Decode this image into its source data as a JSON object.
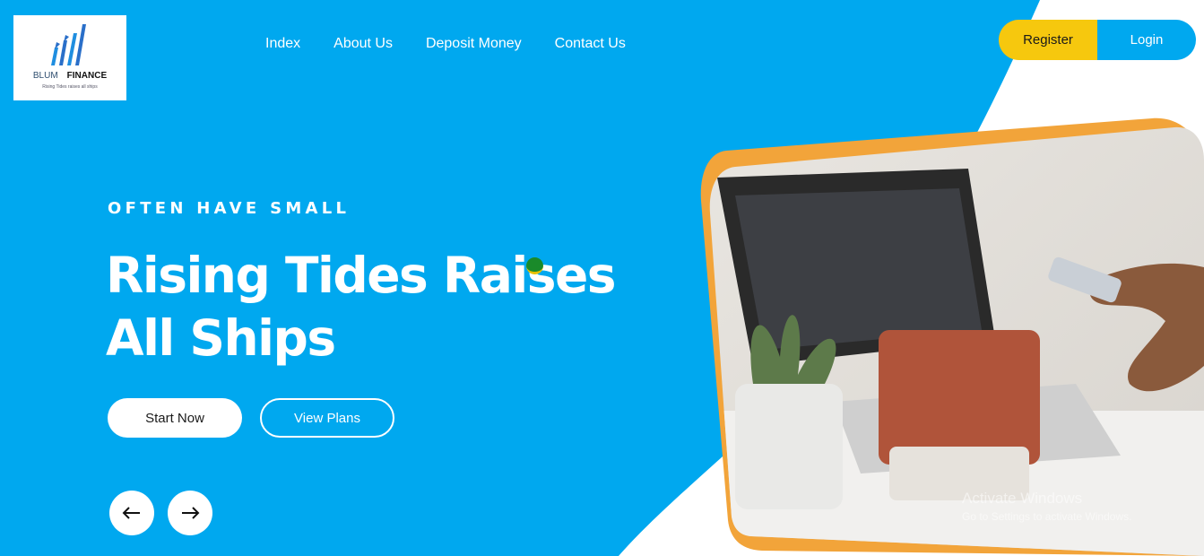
{
  "brand": {
    "name_part1": "BLUM",
    "name_part2": "FINANCE",
    "tagline": "Rising Tides raises all ships"
  },
  "nav": {
    "items": [
      {
        "label": "Index"
      },
      {
        "label": "About Us"
      },
      {
        "label": "Deposit Money"
      },
      {
        "label": "Contact Us"
      }
    ]
  },
  "auth": {
    "register_label": "Register",
    "login_label": "Login"
  },
  "hero": {
    "eyebrow": "OFTEN HAVE SMALL",
    "headline_line1": "Rising Tides Raises",
    "headline_line2": "All Ships",
    "start_label": "Start Now",
    "plans_label": "View Plans",
    "prev_icon": "arrow-left-icon",
    "next_icon": "arrow-right-icon"
  },
  "watermark": {
    "title": "Activate Windows",
    "subtitle": "Go to Settings to activate Windows."
  },
  "colors": {
    "hero_blue": "#00a8ef",
    "accent_yellow": "#f6c80e",
    "frame_orange": "#f2a43a"
  }
}
